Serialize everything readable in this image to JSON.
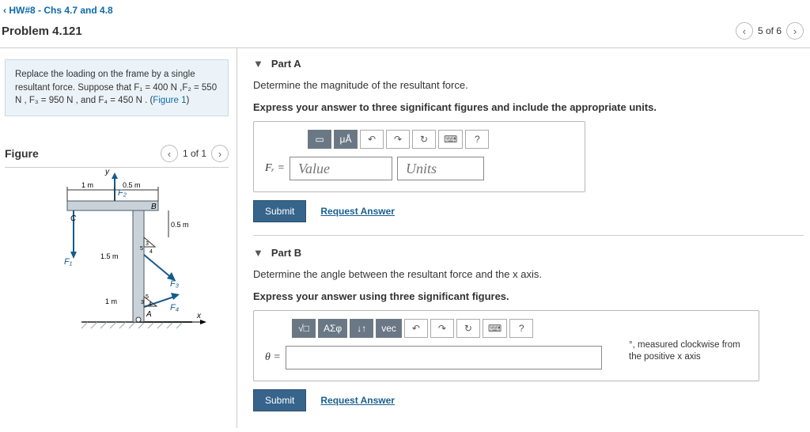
{
  "breadcrumb": {
    "label": "HW#8 - Chs 4.7 and 4.8"
  },
  "problem": {
    "title": "Problem 4.121",
    "counter": "5 of 6"
  },
  "intro": {
    "text_before_link": "Replace the loading on the frame by a single resultant force. Suppose that F₁ = 400  N ,F₂ = 550  N , F₃ = 950  N , and F₄ = 450  N . (",
    "link_text": "Figure 1",
    "text_after_link": ")"
  },
  "figure": {
    "heading": "Figure",
    "counter": "1 of 1",
    "labels": {
      "y": "y",
      "x": "x",
      "d1": "1 m",
      "d2": "0.5 m",
      "d3": "0.5 m",
      "d4": "1.5 m",
      "d5": "1 m",
      "C": "C",
      "B": "B",
      "A": "A",
      "F1": "F₁",
      "F2": "F₂",
      "F3": "F₃",
      "F4": "F₄",
      "a1": "3",
      "a2": "4",
      "a3": "5"
    }
  },
  "partA": {
    "title": "Part A",
    "instr": "Determine the magnitude of the resultant force.",
    "emph": "Express your answer to three significant figures and include the appropriate units.",
    "var_label": "Fᵣ =",
    "value_ph": "Value",
    "units_ph": "Units",
    "submit": "Submit",
    "request": "Request Answer",
    "tb": {
      "mu": "μÅ",
      "undo": "↶",
      "redo": "↷",
      "reset": "↻",
      "kb": "⌨",
      "help": "?"
    }
  },
  "partB": {
    "title": "Part B",
    "instr": "Determine the angle between the resultant force and the x axis.",
    "emph": "Express your answer using three significant figures.",
    "var_label": "θ =",
    "note": "°, measured clockwise from the positive x axis",
    "submit": "Submit",
    "request": "Request Answer",
    "tb": {
      "sigma": "ΑΣφ",
      "sort": "↓↑",
      "vec": "vec",
      "undo": "↶",
      "redo": "↷",
      "reset": "↻",
      "kb": "⌨",
      "help": "?"
    }
  }
}
